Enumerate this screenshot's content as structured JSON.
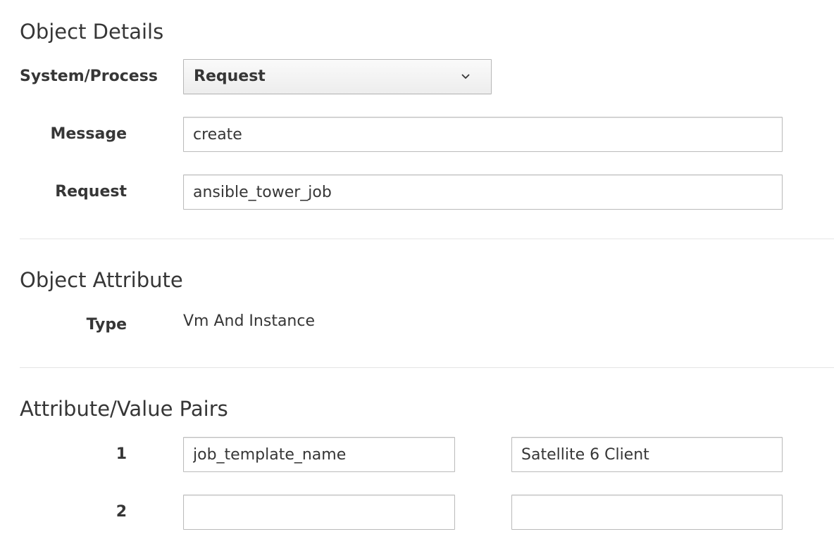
{
  "object_details": {
    "title": "Object Details",
    "system_process": {
      "label": "System/Process",
      "selected": "Request",
      "icon": "chevron-down-icon"
    },
    "message": {
      "label": "Message",
      "value": "create"
    },
    "request": {
      "label": "Request",
      "value": "ansible_tower_job"
    }
  },
  "object_attribute": {
    "title": "Object Attribute",
    "type": {
      "label": "Type",
      "value": "Vm And Instance"
    }
  },
  "attribute_value_pairs": {
    "title": "Attribute/Value Pairs",
    "rows": [
      {
        "index": "1",
        "attribute": "job_template_name",
        "value": "Satellite 6 Client"
      },
      {
        "index": "2",
        "attribute": "",
        "value": ""
      }
    ]
  }
}
